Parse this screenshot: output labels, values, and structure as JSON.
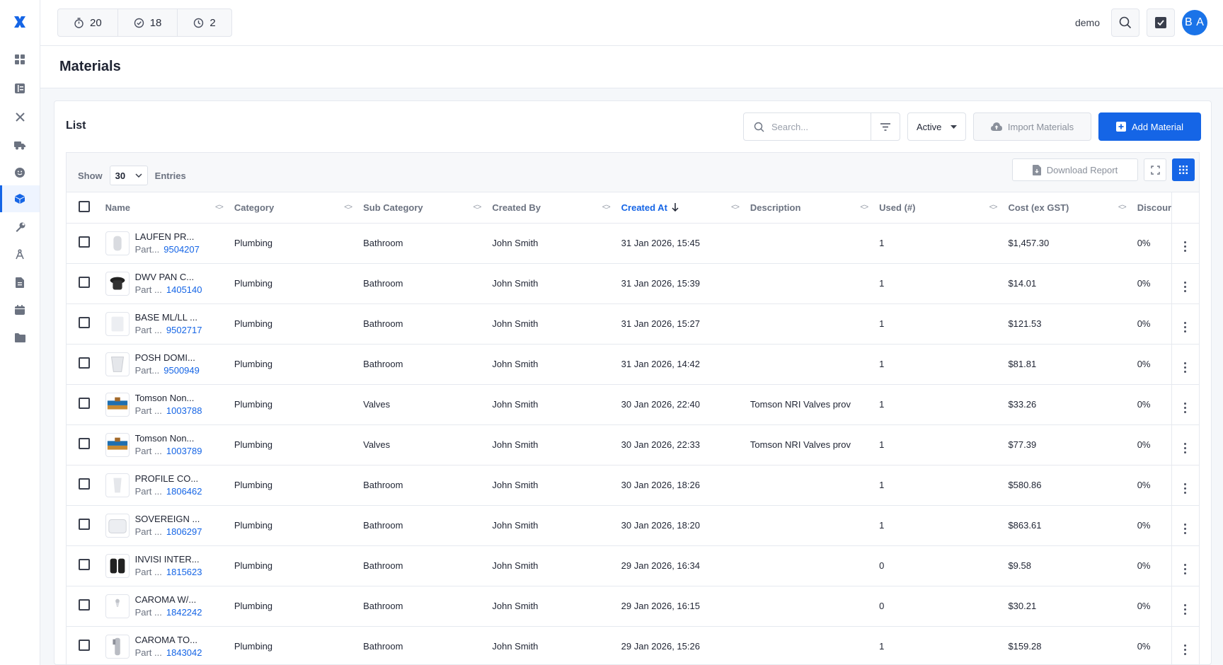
{
  "topbar": {
    "counters": [
      {
        "icon": "timer-icon",
        "value": "20"
      },
      {
        "icon": "check-circle-icon",
        "value": "18"
      },
      {
        "icon": "clock-icon",
        "value": "2"
      }
    ],
    "username": "demo",
    "avatar_initials": "B A"
  },
  "sidebar": {
    "items": [
      {
        "icon": "dashboard-icon"
      },
      {
        "icon": "list-icon"
      },
      {
        "icon": "tools-icon"
      },
      {
        "icon": "truck-icon"
      },
      {
        "icon": "smiley-icon"
      },
      {
        "icon": "box-icon",
        "active": true
      },
      {
        "icon": "wrench-icon"
      },
      {
        "icon": "compass-icon"
      },
      {
        "icon": "document-icon"
      },
      {
        "icon": "calendar-icon"
      },
      {
        "icon": "folder-icon"
      }
    ]
  },
  "page": {
    "title": "Materials"
  },
  "list": {
    "title": "List",
    "search_placeholder": "Search...",
    "status_filter": "Active",
    "import_label": "Import Materials",
    "add_label": "Add Material",
    "show_label": "Show",
    "entries_value": "30",
    "entries_label": "Entries",
    "download_label": "Download Report"
  },
  "table": {
    "columns": [
      "Name",
      "Category",
      "Sub Category",
      "Created By",
      "Created At",
      "Description",
      "Used (#)",
      "Cost (ex GST)",
      "Discour"
    ],
    "rows": [
      {
        "name": "LAUFEN PR...",
        "part_label": "Part...",
        "part_no": "9504207",
        "category": "Plumbing",
        "sub_category": "Bathroom",
        "created_by": "John Smith",
        "created_at": "31 Jan 2026, 15:45",
        "description": "",
        "used": "1",
        "cost": "$1,457.30",
        "discount": "0%"
      },
      {
        "name": "DWV PAN C...",
        "part_label": "Part ...",
        "part_no": "1405140",
        "category": "Plumbing",
        "sub_category": "Bathroom",
        "created_by": "John Smith",
        "created_at": "31 Jan 2026, 15:39",
        "description": "",
        "used": "1",
        "cost": "$14.01",
        "discount": "0%"
      },
      {
        "name": "BASE ML/LL ...",
        "part_label": "Part ...",
        "part_no": "9502717",
        "category": "Plumbing",
        "sub_category": "Bathroom",
        "created_by": "John Smith",
        "created_at": "31 Jan 2026, 15:27",
        "description": "",
        "used": "1",
        "cost": "$121.53",
        "discount": "0%"
      },
      {
        "name": "POSH DOMI...",
        "part_label": "Part...",
        "part_no": "9500949",
        "category": "Plumbing",
        "sub_category": "Bathroom",
        "created_by": "John Smith",
        "created_at": "31 Jan 2026, 14:42",
        "description": "",
        "used": "1",
        "cost": "$81.81",
        "discount": "0%"
      },
      {
        "name": "Tomson Non...",
        "part_label": "Part ...",
        "part_no": "1003788",
        "category": "Plumbing",
        "sub_category": "Valves",
        "created_by": "John Smith",
        "created_at": "30 Jan 2026, 22:40",
        "description": "Tomson NRI Valves prov",
        "used": "1",
        "cost": "$33.26",
        "discount": "0%"
      },
      {
        "name": "Tomson Non...",
        "part_label": "Part ...",
        "part_no": "1003789",
        "category": "Plumbing",
        "sub_category": "Valves",
        "created_by": "John Smith",
        "created_at": "30 Jan 2026, 22:33",
        "description": "Tomson NRI Valves prov",
        "used": "1",
        "cost": "$77.39",
        "discount": "0%"
      },
      {
        "name": "PROFILE CO...",
        "part_label": "Part ...",
        "part_no": "1806462",
        "category": "Plumbing",
        "sub_category": "Bathroom",
        "created_by": "John Smith",
        "created_at": "30 Jan 2026, 18:26",
        "description": "",
        "used": "1",
        "cost": "$580.86",
        "discount": "0%"
      },
      {
        "name": "SOVEREIGN ...",
        "part_label": "Part ...",
        "part_no": "1806297",
        "category": "Plumbing",
        "sub_category": "Bathroom",
        "created_by": "John Smith",
        "created_at": "30 Jan 2026, 18:20",
        "description": "",
        "used": "1",
        "cost": "$863.61",
        "discount": "0%"
      },
      {
        "name": "INVISI INTER...",
        "part_label": "Part ...",
        "part_no": "1815623",
        "category": "Plumbing",
        "sub_category": "Bathroom",
        "created_by": "John Smith",
        "created_at": "29 Jan 2026, 16:34",
        "description": "",
        "used": "0",
        "cost": "$9.58",
        "discount": "0%"
      },
      {
        "name": "CAROMA W/...",
        "part_label": "Part ...",
        "part_no": "1842242",
        "category": "Plumbing",
        "sub_category": "Bathroom",
        "created_by": "John Smith",
        "created_at": "29 Jan 2026, 16:15",
        "description": "",
        "used": "0",
        "cost": "$30.21",
        "discount": "0%"
      },
      {
        "name": "CAROMA TO...",
        "part_label": "Part ...",
        "part_no": "1843042",
        "category": "Plumbing",
        "sub_category": "Bathroom",
        "created_by": "John Smith",
        "created_at": "29 Jan 2026, 15:26",
        "description": "",
        "used": "1",
        "cost": "$159.28",
        "discount": "0%"
      }
    ]
  },
  "colors": {
    "accent": "#1565e6",
    "part_number": "#1565e6"
  }
}
